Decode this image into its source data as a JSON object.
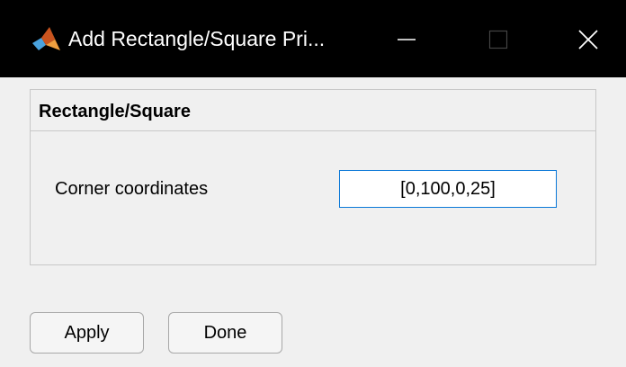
{
  "window": {
    "title": "Add Rectangle/Square Pri...",
    "icon": "matlab-logo-icon",
    "controls": [
      "minimize-icon",
      "maximize-icon",
      "close-icon"
    ]
  },
  "panel": {
    "title": "Rectangle/Square",
    "field_label": "Corner coordinates",
    "field_value": "[0,100,0,25]"
  },
  "buttons": {
    "apply_label": "Apply",
    "done_label": "Done"
  },
  "colors": {
    "titlebar": "#000000",
    "background": "#f0f0f0",
    "focus_border": "#0a78d7"
  }
}
